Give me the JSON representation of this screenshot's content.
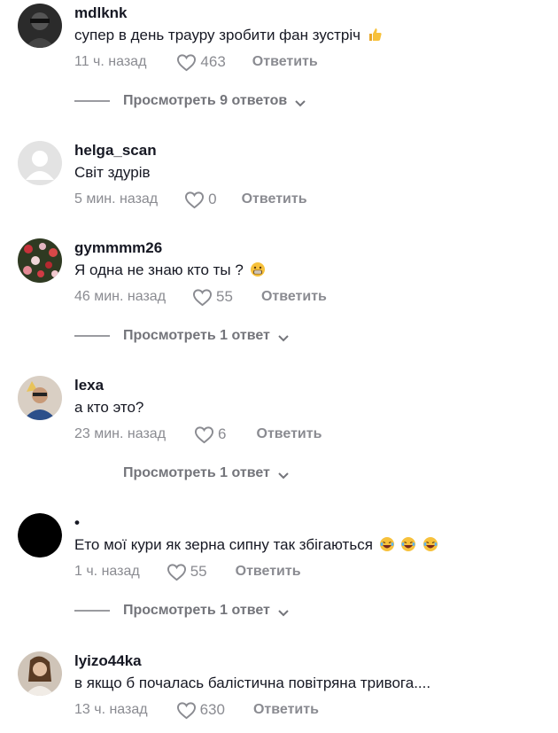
{
  "comments": [
    {
      "username": "mdlknk",
      "text": "супер в день трауру зробити фан зустріч",
      "emoji": "thumbs-up",
      "time": "11 ч. назад",
      "likes": "463",
      "reply_label": "Ответить",
      "view_replies": "Просмотреть 9 ответов"
    },
    {
      "username": "helga_scan",
      "text": "Світ здурів",
      "time": "5 мин. назад",
      "likes": "0",
      "reply_label": "Ответить"
    },
    {
      "username": "gymmmm26",
      "text": "Я одна не знаю кто ты ?",
      "emoji": "grimacing-face",
      "time": "46 мин. назад",
      "likes": "55",
      "reply_label": "Ответить",
      "view_replies": "Просмотреть 1 ответ"
    },
    {
      "username": "lexa",
      "text": "а кто это?",
      "time": "23 мин. назад",
      "likes": "6",
      "reply_label": "Ответить",
      "view_replies": "Просмотреть 1 ответ"
    },
    {
      "username": "•",
      "text": "Ето мої кури як зерна сипну так збігаються",
      "emoji": "laughing-face x3",
      "time": "1 ч. назад",
      "likes": "55",
      "reply_label": "Ответить",
      "view_replies": "Просмотреть 1 ответ"
    },
    {
      "username": "lyizo44ka",
      "text": "в якщо б почалась балістична повітряна тривога....",
      "time": "13 ч. назад",
      "likes": "630",
      "reply_label": "Ответить"
    }
  ]
}
